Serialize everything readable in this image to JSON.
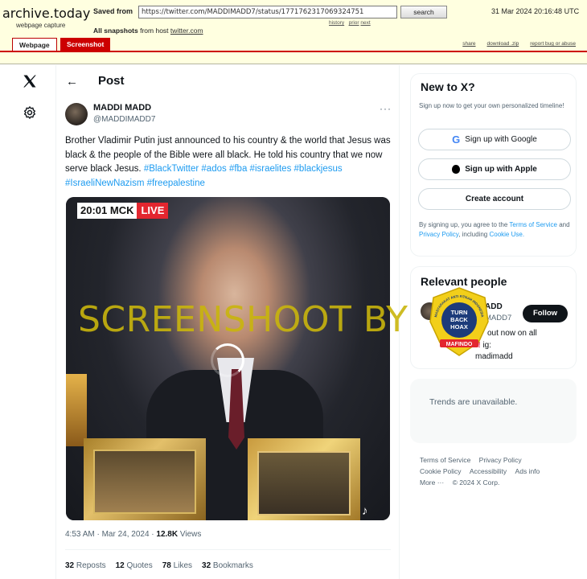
{
  "archive": {
    "logo": "archive.today",
    "subtitle": "webpage capture",
    "saved_from_label": "Saved from",
    "url": "https://twitter.com/MADDIMADD7/status/1771762317069324751",
    "search_button": "search",
    "datetime": "31 Mar 2024 20:16:48 UTC",
    "history_link": "history",
    "prior_link": "prior",
    "next_link": "next",
    "all_snapshots_label": "All snapshots",
    "from_host_label": "from host",
    "host": "twitter.com",
    "tab_webpage": "Webpage",
    "tab_screenshot": "Screenshot",
    "share_link": "share",
    "download_link": "download .zip",
    "report_link": "report bug or abuse"
  },
  "post": {
    "header_title": "Post",
    "author_name": "MADDI MADD",
    "author_handle": "@MADDIMADD7",
    "text_main": "Brother Vladimir Putin just announced to his country & the world that Jesus was black & the people of the Bible were all black. He told his country that we now serve black Jesus.",
    "hashtags": [
      "#BlackTwitter",
      "#ados",
      "#fba",
      "#israelites",
      "#blackjesus",
      "#IsraeliNewNazism",
      "#freepalestine"
    ],
    "video_time": "20:01 MCK",
    "video_live": "LIVE",
    "timestamp": "4:53 AM · Mar 24, 2024",
    "views_count": "12.8K",
    "views_label": "Views",
    "reposts_count": "32",
    "reposts_label": "Reposts",
    "quotes_count": "12",
    "quotes_label": "Quotes",
    "likes_count": "78",
    "likes_label": "Likes",
    "bookmarks_count": "32",
    "bookmarks_label": "Bookmarks"
  },
  "watermark": "SCREENSHOOT BY",
  "new_to_x": {
    "title": "New to X?",
    "description": "Sign up now to get your own personalized timeline!",
    "google_button": "Sign up with Google",
    "apple_button": "Sign up with Apple",
    "create_button": "Create account",
    "legal_prefix": "By signing up, you agree to the",
    "terms_link": "Terms of Service",
    "and_text": "and",
    "privacy_link": "Privacy Policy",
    "including_text": ", including",
    "cookie_link": "Cookie Use."
  },
  "relevant": {
    "title": "Relevant people",
    "name_partial": "ADD",
    "handle_partial": "MADD7",
    "follow_button": "Follow",
    "bio_line1": "out now on all",
    "bio_line2_marks": "!!",
    "bio_line2_rest": "ig:",
    "bio_line3": "madimadd"
  },
  "badge": {
    "ring_text": "MASYARAKAT ANTI FITNAH INDONESIA",
    "center_text_1": "TURN",
    "center_text_2": "BACK",
    "center_text_3": "HOAX",
    "banner_text": "MAFINDO"
  },
  "trends": {
    "message": "Trends are unavailable."
  },
  "footer": {
    "links": [
      "Terms of Service",
      "Privacy Policy",
      "Cookie Policy",
      "Accessibility",
      "Ads info",
      "More ···",
      "© 2024 X Corp."
    ]
  },
  "colors": {
    "accent": "#1d9bf0",
    "archive_red": "#cc0000",
    "watermark": "#c9b50d"
  }
}
